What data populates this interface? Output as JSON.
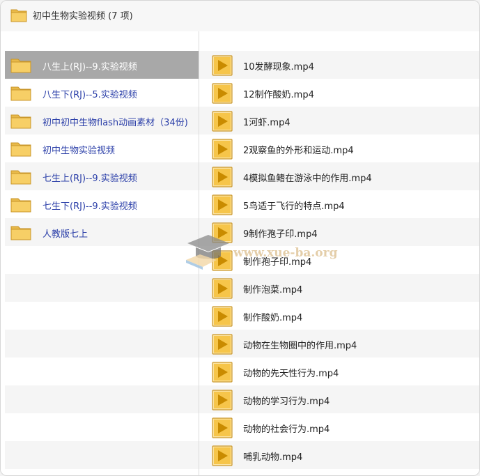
{
  "window": {
    "title": "初中生物实验视频 (7 项)",
    "icon": "folder-icon"
  },
  "sidebar": {
    "items": [
      {
        "label": "八生上(RJ)--9.实验视频",
        "selected": true
      },
      {
        "label": "八生下(RJ)--5.实验视频",
        "selected": false
      },
      {
        "label": "初中初中生物flash动画素材（34份)",
        "selected": false
      },
      {
        "label": "初中生物实验视频",
        "selected": false
      },
      {
        "label": "七生上(RJ)--9.实验视频",
        "selected": false
      },
      {
        "label": "七生下(RJ)--9.实验视频",
        "selected": false
      },
      {
        "label": "人教版七上",
        "selected": false
      }
    ]
  },
  "files": {
    "items": [
      {
        "name": "10发酵现象.mp4"
      },
      {
        "name": "12制作酸奶.mp4"
      },
      {
        "name": "1河虾.mp4"
      },
      {
        "name": "2观察鱼的外形和运动.mp4"
      },
      {
        "name": "4模拟鱼鳍在游泳中的作用.mp4"
      },
      {
        "name": "5鸟适于飞行的特点.mp4"
      },
      {
        "name": "9制作孢子印.mp4"
      },
      {
        "name": "制作孢子印.mp4"
      },
      {
        "name": "制作泡菜.mp4"
      },
      {
        "name": "制作酸奶.mp4"
      },
      {
        "name": "动物在生物圈中的作用.mp4"
      },
      {
        "name": "动物的先天性行为.mp4"
      },
      {
        "name": "动物的学习行为.mp4"
      },
      {
        "name": "动物的社会行为.mp4"
      },
      {
        "name": "哺乳动物.mp4"
      }
    ]
  },
  "watermark": {
    "text": "www.xue-ba.org"
  },
  "colors": {
    "folder": "#f5c75a",
    "video_tile": "#f6c54a",
    "play": "#c98b00",
    "selected_row": "#a8a8a8",
    "link_text": "#2a3ea8"
  }
}
